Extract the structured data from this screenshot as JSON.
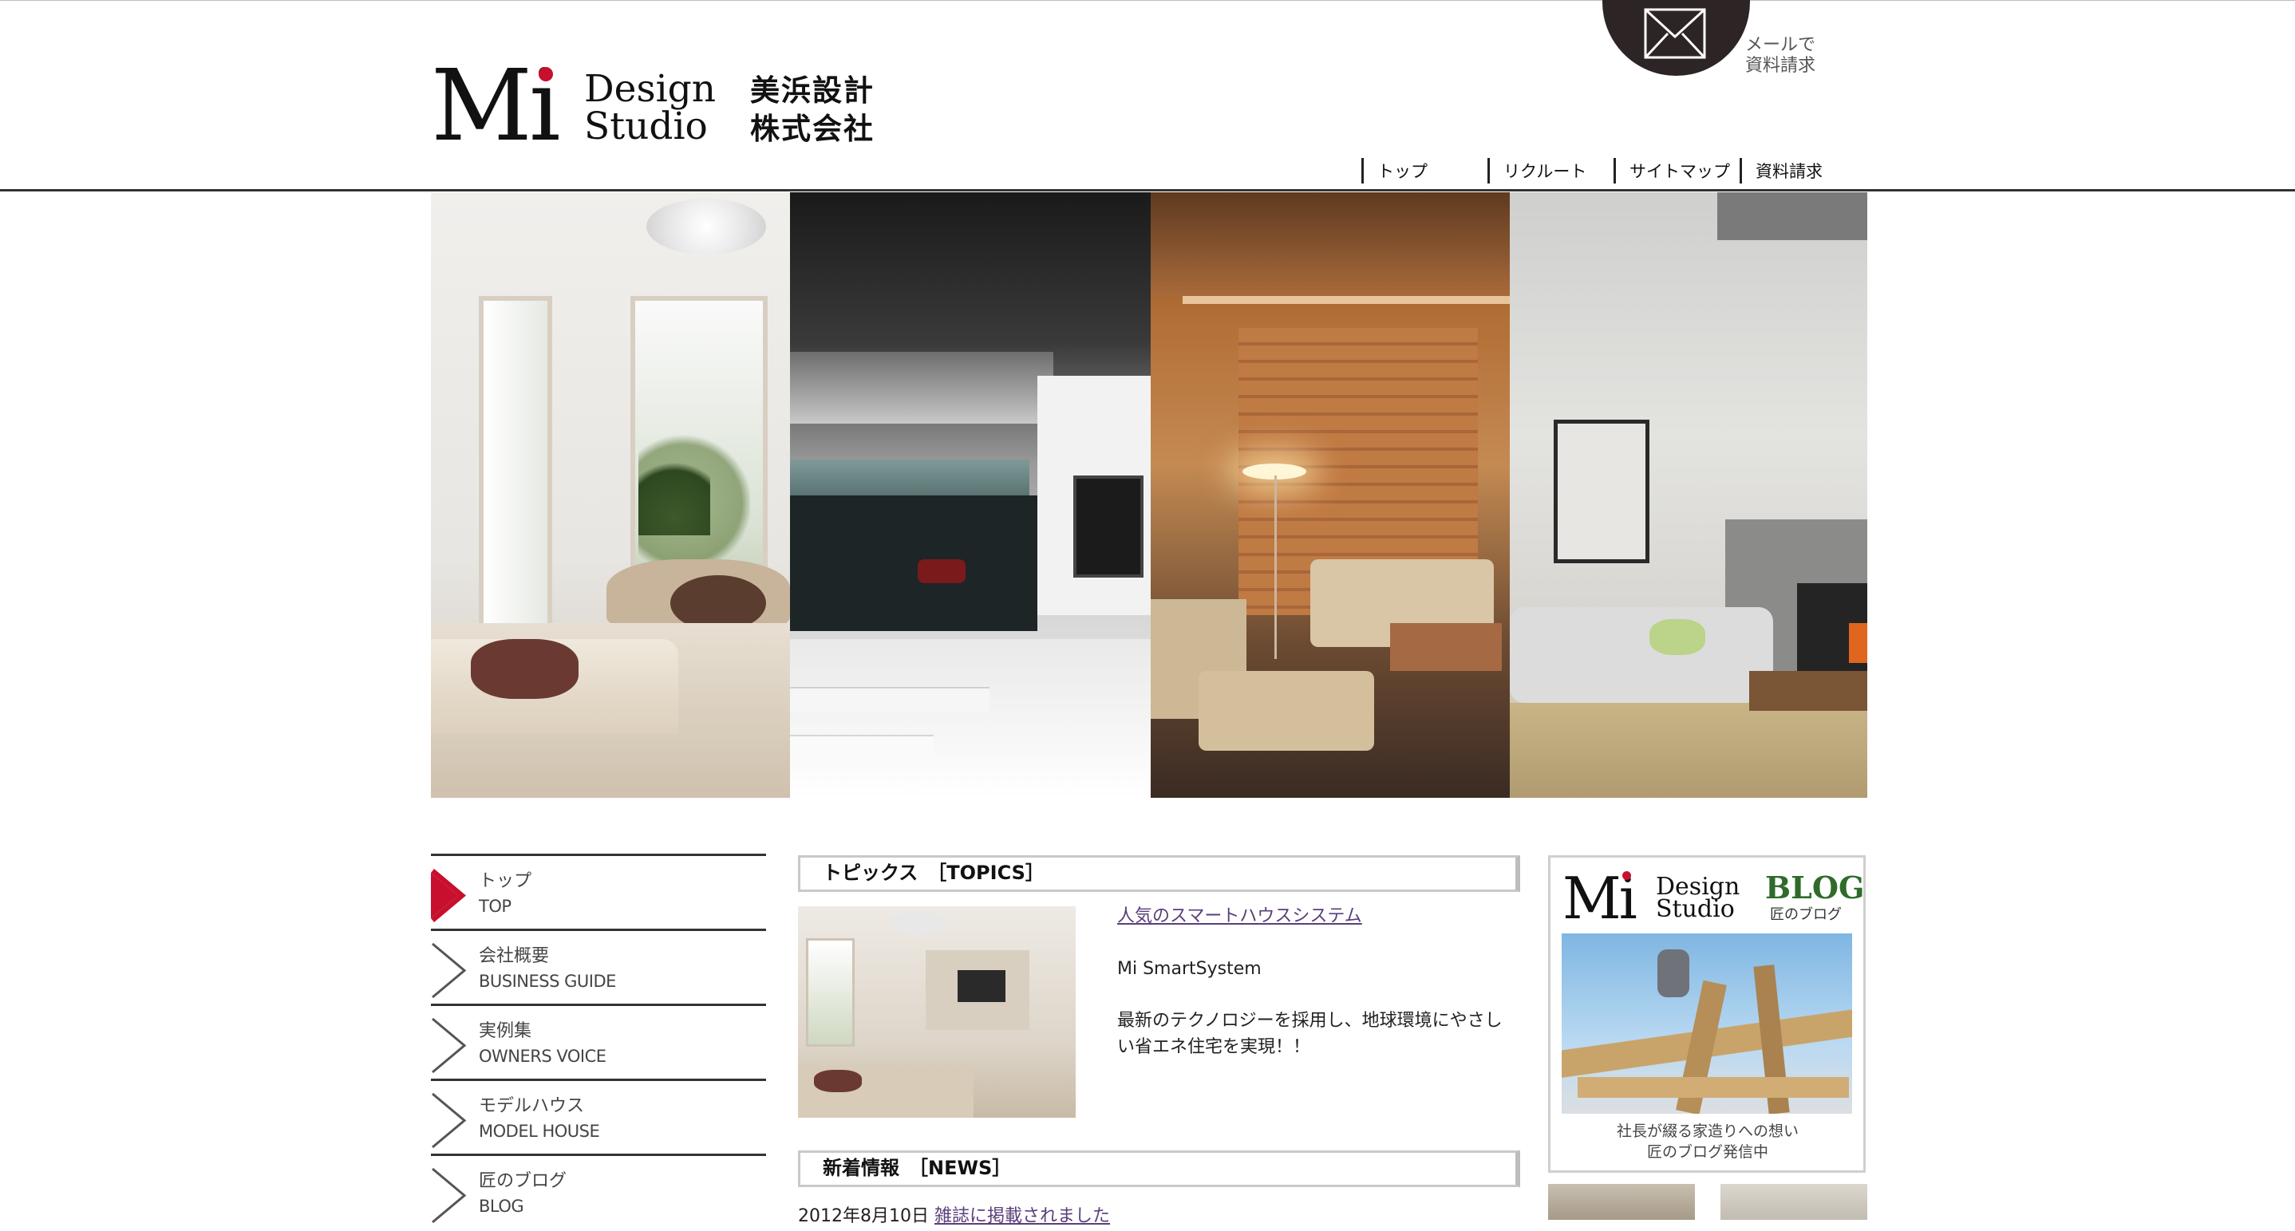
{
  "header": {
    "logo": {
      "mi": "Mi",
      "design": "Design",
      "studio": "Studio",
      "company_line1": "美浜設計",
      "company_line2": "株式会社"
    },
    "mail_request": {
      "line1": "メールで",
      "line2": "資料請求",
      "icon": "envelope-icon"
    },
    "nav": [
      {
        "label": "トップ"
      },
      {
        "label": "リクルート"
      },
      {
        "label": "サイトマップ"
      },
      {
        "label": "資料請求"
      }
    ]
  },
  "side_menu": [
    {
      "ja": "トップ",
      "en": "TOP",
      "active": true
    },
    {
      "ja": "会社概要",
      "en": "BUSINESS GUIDE",
      "active": false
    },
    {
      "ja": "実例集",
      "en": "OWNERS VOICE",
      "active": false
    },
    {
      "ja": "モデルハウス",
      "en": "MODEL HOUSE",
      "active": false
    },
    {
      "ja": "匠のブログ",
      "en": "BLOG",
      "active": false
    }
  ],
  "topics": {
    "heading": "トピックス　［TOPICS］",
    "link": "人気のスマートハウスシステム",
    "subtitle": "Mi SmartSystem",
    "body": "最新のテクノロジーを採用し、地球環境にやさしい省エネ住宅を実現！！"
  },
  "news": {
    "heading": "新着情報　［NEWS］",
    "date": "2012年8月10日",
    "link": "雑誌に掲載されました"
  },
  "blog_card": {
    "mi": "Mi",
    "design": "Design",
    "studio": "Studio",
    "blog": "BLOG",
    "blog_sub": "匠のブログ",
    "caption_line1": "社長が綴る家造りへの想い",
    "caption_line2": "匠のブログ発信中"
  },
  "colors": {
    "accent_red": "#c8102e",
    "blog_green": "#2f6b2a",
    "link_purple": "#5a3e7a"
  }
}
